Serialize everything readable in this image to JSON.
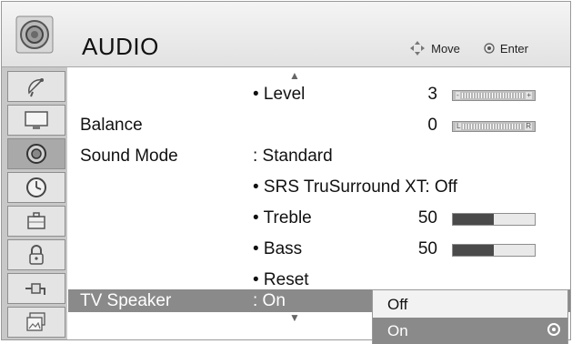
{
  "header": {
    "title": "AUDIO",
    "move_hint": "Move",
    "enter_hint": "Enter",
    "icon": "speaker-disc-icon"
  },
  "sidebar": {
    "items": [
      {
        "icon": "satellite-dish-icon"
      },
      {
        "icon": "tv-monitor-icon"
      },
      {
        "icon": "audio-speaker-icon",
        "active": true
      },
      {
        "icon": "clock-icon"
      },
      {
        "icon": "briefcase-icon"
      },
      {
        "icon": "padlock-icon"
      },
      {
        "icon": "plug-connector-icon"
      },
      {
        "icon": "picture-album-icon"
      }
    ]
  },
  "main": {
    "scroll_up": "▲",
    "scroll_down": "▼",
    "rows": [
      {
        "label": "",
        "value": "• Level",
        "number": "3",
        "left_end": "-",
        "right_end": "+"
      },
      {
        "label": "Balance",
        "value": "",
        "number": "0",
        "left_end": "L",
        "right_end": "R"
      },
      {
        "label": "Sound Mode",
        "value": ": Standard",
        "number": ""
      },
      {
        "label": "",
        "value": "• SRS TruSurround XT: Off",
        "number": ""
      },
      {
        "label": "",
        "value": "• Treble",
        "number": "50",
        "level": 0.5
      },
      {
        "label": "",
        "value": "• Bass",
        "number": "50",
        "level": 0.5
      },
      {
        "label": "",
        "value": "• Reset",
        "number": ""
      },
      {
        "label": "TV Speaker",
        "value": ": On",
        "number": "",
        "selected": true
      }
    ]
  },
  "dropdown": {
    "options": [
      {
        "label": "Off",
        "selected": false
      },
      {
        "label": "On",
        "selected": true
      }
    ]
  },
  "colors": {
    "highlight": "#8a8a8a",
    "sidebar_bg": "#c8c8c8",
    "level_fill": "#4a4a4a"
  }
}
